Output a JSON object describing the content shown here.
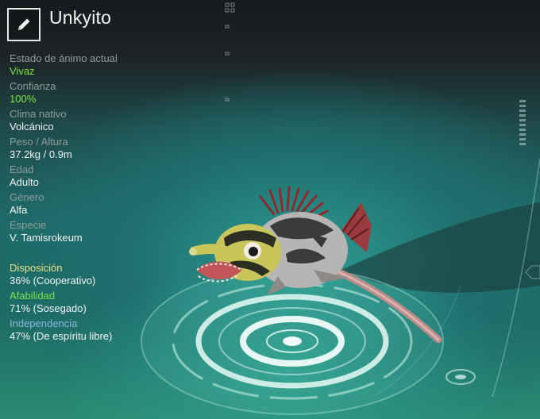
{
  "creature": {
    "name": "Unkyito"
  },
  "stats": [
    {
      "label": "Estado de ánimo actual",
      "value": "Vivaz",
      "highlight": true
    },
    {
      "label": "Confianza",
      "value": "100%",
      "highlight": true
    },
    {
      "label": "Clima nativo",
      "value": "Volcánico"
    },
    {
      "label": "Peso / Altura",
      "value": "37.2kg / 0.9m"
    },
    {
      "label": "Edad",
      "value": "Adulto"
    },
    {
      "label": "Género",
      "value": "Alfa"
    },
    {
      "label": "Especie",
      "value": "V. Tamisrokeum"
    }
  ],
  "traits": [
    {
      "label": "Disposición",
      "value": "36% (Cooperativo)",
      "color": "#e6e08a"
    },
    {
      "label": "Afabilidad",
      "value": "71% (Sosegado)",
      "color": "#7ee34a"
    },
    {
      "label": "Independencia",
      "value": "47% (De espíritu libre)",
      "color": "#8fb6d8"
    }
  ],
  "icons": {
    "edit": "pencil-icon"
  }
}
